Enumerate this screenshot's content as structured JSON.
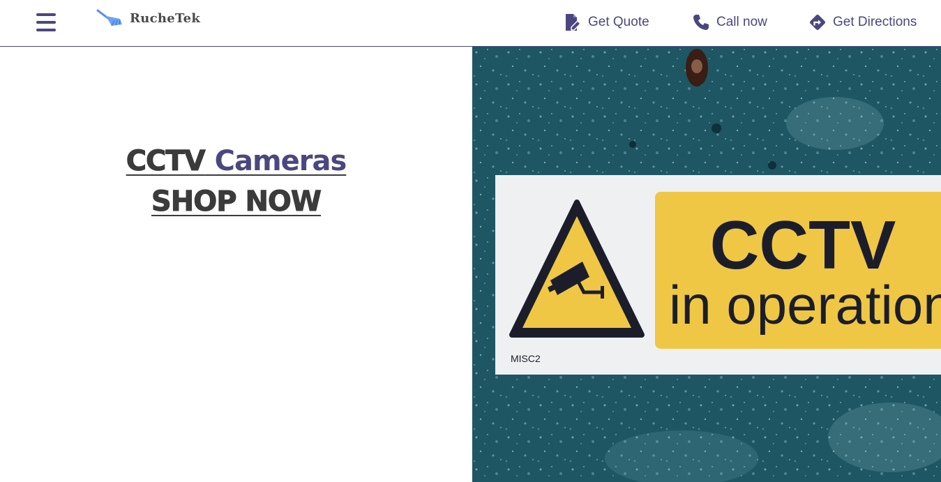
{
  "brand": {
    "name": "RucheTek",
    "color": "#4a4780"
  },
  "nav": [
    {
      "label": "Get Quote",
      "icon": "quote-icon"
    },
    {
      "label": "Call now",
      "icon": "phone-icon"
    },
    {
      "label": "Get Directions",
      "icon": "directions-icon"
    }
  ],
  "hero": {
    "title_part1": "CCTV",
    "title_part2": "Cameras",
    "cta": "SHOP NOW"
  },
  "sign": {
    "line1": "CCTV",
    "line2": "in operation",
    "code": "MISC2",
    "colors": {
      "background": "#1e5663",
      "plate": "#eef0f2",
      "yellow": "#efc744",
      "ink": "#1b1e2a"
    }
  }
}
